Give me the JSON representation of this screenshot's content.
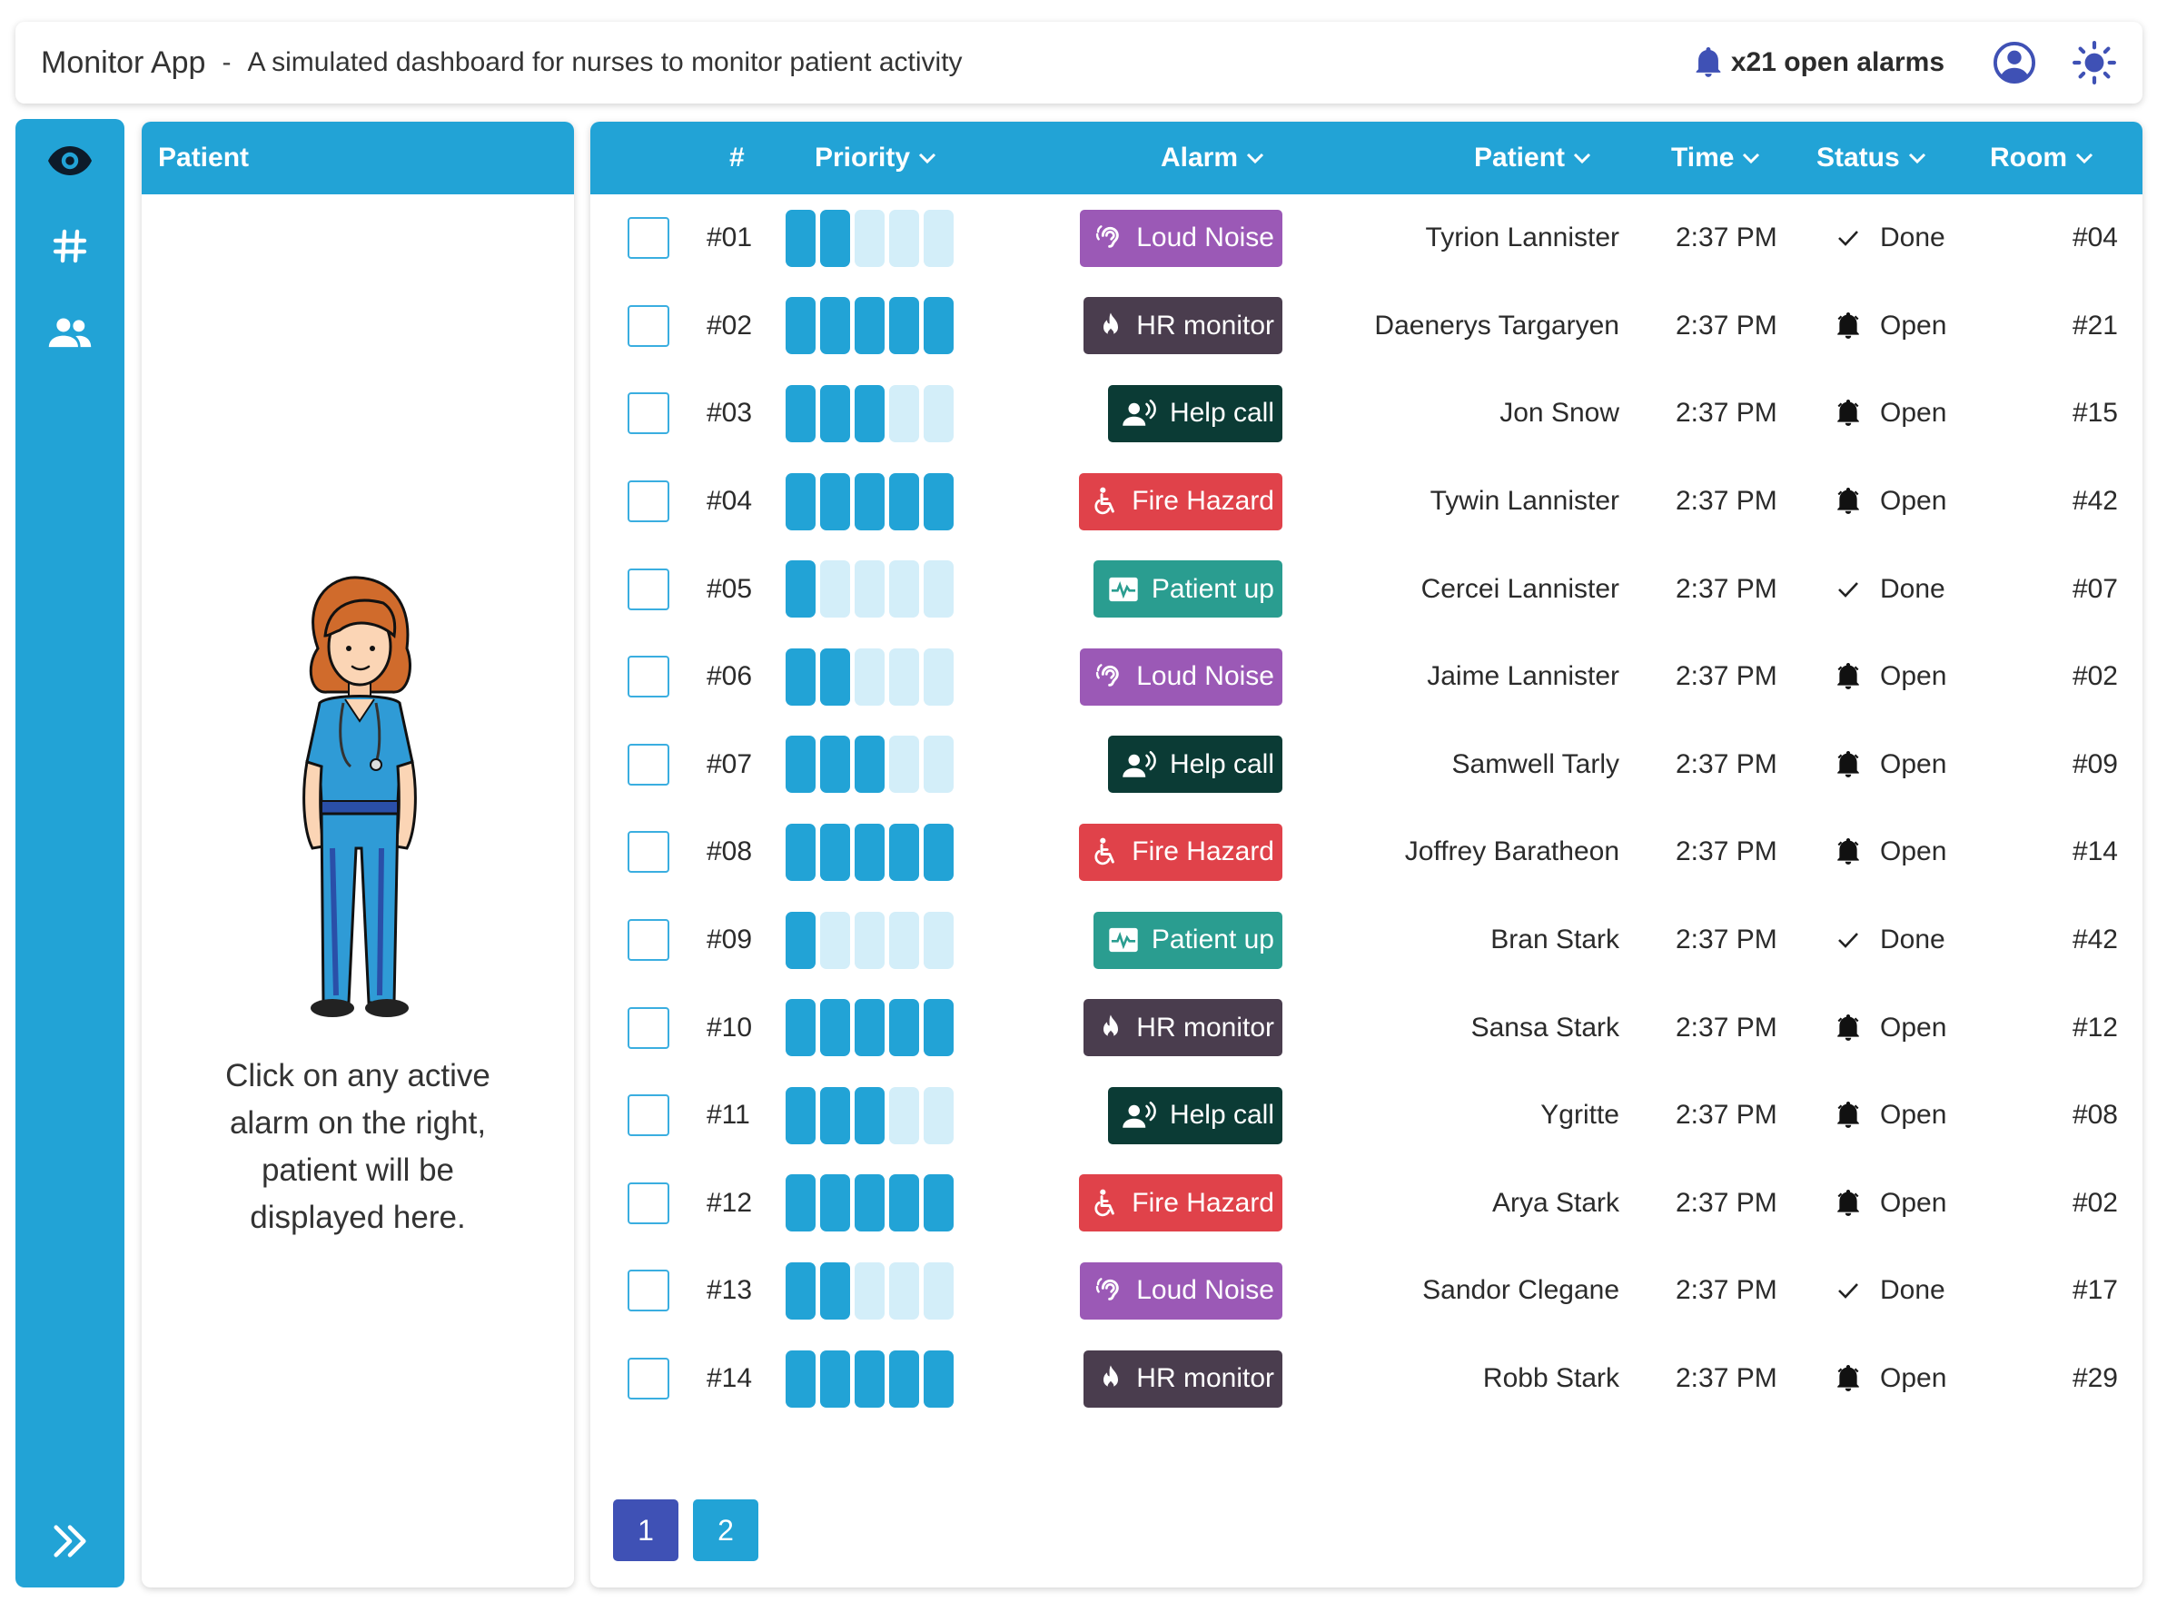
{
  "header": {
    "app_name": "Monitor App",
    "separator": "-",
    "description": "A simulated dashboard for nurses to monitor patient activity",
    "open_alarms": "x21 open alarms",
    "bell_icon": "bell-icon",
    "user_icon": "account-circle-icon",
    "theme_icon": "sun-icon"
  },
  "nav": {
    "items": [
      "eye-icon",
      "hash-icon",
      "people-icon"
    ],
    "expand_icon": "double-chevron-right-icon"
  },
  "patient_panel": {
    "title": "Patient",
    "message": "Click on any active alarm on the right, patient will be displayed here."
  },
  "table": {
    "columns": {
      "number": "#",
      "priority": "Priority",
      "alarm": "Alarm",
      "patient": "Patient",
      "time": "Time",
      "status": "Status",
      "room": "Room"
    },
    "rows": [
      {
        "id": "#01",
        "priority": 2,
        "alarm": "Loud Noise",
        "patient": "Tyrion Lannister",
        "time": "2:37 PM",
        "status": "Done",
        "room": "#04"
      },
      {
        "id": "#02",
        "priority": 5,
        "alarm": "HR monitor",
        "patient": "Daenerys Targaryen",
        "time": "2:37 PM",
        "status": "Open",
        "room": "#21"
      },
      {
        "id": "#03",
        "priority": 3,
        "alarm": "Help call",
        "patient": "Jon Snow",
        "time": "2:37 PM",
        "status": "Open",
        "room": "#15"
      },
      {
        "id": "#04",
        "priority": 5,
        "alarm": "Fire Hazard",
        "patient": "Tywin Lannister",
        "time": "2:37 PM",
        "status": "Open",
        "room": "#42"
      },
      {
        "id": "#05",
        "priority": 1,
        "alarm": "Patient up",
        "patient": "Cercei Lannister",
        "time": "2:37 PM",
        "status": "Done",
        "room": "#07"
      },
      {
        "id": "#06",
        "priority": 2,
        "alarm": "Loud Noise",
        "patient": "Jaime Lannister",
        "time": "2:37 PM",
        "status": "Open",
        "room": "#02"
      },
      {
        "id": "#07",
        "priority": 3,
        "alarm": "Help call",
        "patient": "Samwell Tarly",
        "time": "2:37 PM",
        "status": "Open",
        "room": "#09"
      },
      {
        "id": "#08",
        "priority": 5,
        "alarm": "Fire Hazard",
        "patient": "Joffrey Baratheon",
        "time": "2:37 PM",
        "status": "Open",
        "room": "#14"
      },
      {
        "id": "#09",
        "priority": 1,
        "alarm": "Patient up",
        "patient": "Bran Stark",
        "time": "2:37 PM",
        "status": "Done",
        "room": "#42"
      },
      {
        "id": "#10",
        "priority": 5,
        "alarm": "HR monitor",
        "patient": "Sansa Stark",
        "time": "2:37 PM",
        "status": "Open",
        "room": "#12"
      },
      {
        "id": "#11",
        "priority": 3,
        "alarm": "Help call",
        "patient": "Ygritte",
        "time": "2:37 PM",
        "status": "Open",
        "room": "#08"
      },
      {
        "id": "#12",
        "priority": 5,
        "alarm": "Fire Hazard",
        "patient": "Arya Stark",
        "time": "2:37 PM",
        "status": "Open",
        "room": "#02"
      },
      {
        "id": "#13",
        "priority": 2,
        "alarm": "Loud Noise",
        "patient": "Sandor Clegane",
        "time": "2:37 PM",
        "status": "Done",
        "room": "#17"
      },
      {
        "id": "#14",
        "priority": 5,
        "alarm": "HR monitor",
        "patient": "Robb Stark",
        "time": "2:37 PM",
        "status": "Open",
        "room": "#29"
      }
    ]
  },
  "alarm_types": {
    "Loud Noise": {
      "color": "#9b59b6",
      "icon": "ear-icon"
    },
    "HR monitor": {
      "color": "#4a3d4e",
      "icon": "flame-icon"
    },
    "Help call": {
      "color": "#0b3b35",
      "icon": "person-voice-icon"
    },
    "Fire Hazard": {
      "color": "#e0424a",
      "icon": "wheelchair-icon"
    },
    "Patient up": {
      "color": "#2a9d90",
      "icon": "pulse-monitor-icon"
    }
  },
  "pagination": {
    "pages": [
      "1",
      "2"
    ],
    "active_color": "#3f51b5",
    "inactive_color": "#22a3d6"
  },
  "colors": {
    "primary": "#22a3d6",
    "priority_off": "#d3eef9"
  }
}
